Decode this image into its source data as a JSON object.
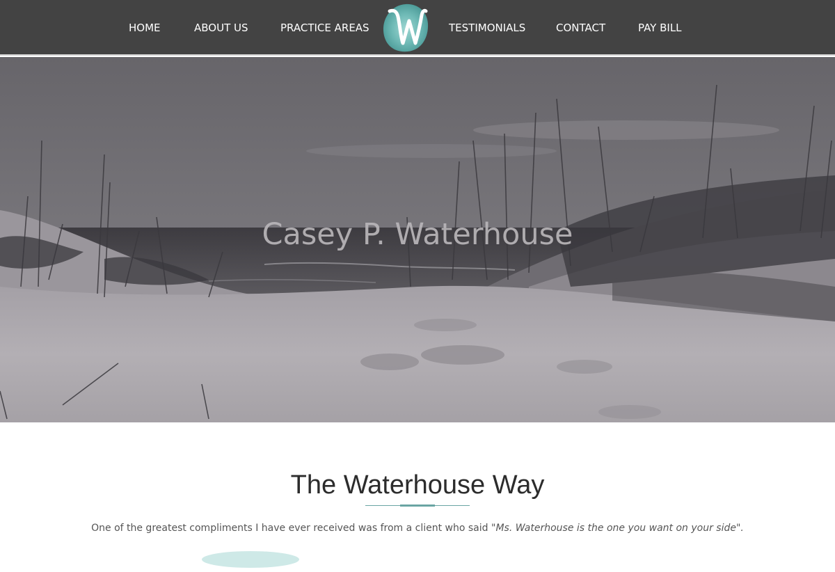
{
  "nav": {
    "items": [
      {
        "label": "HOME"
      },
      {
        "label": "ABOUT US"
      },
      {
        "label": "PRACTICE AREAS"
      },
      {
        "label": "TESTIMONIALS"
      },
      {
        "label": "CONTACT"
      },
      {
        "label": "PAY BILL"
      }
    ],
    "logo": {
      "letter": "W",
      "icon": "watercolor-w-logo",
      "color": "#6fb7b3"
    }
  },
  "hero": {
    "title": "Casey P. Waterhouse",
    "image": "beach-dunes-grass-grayscale"
  },
  "main": {
    "title": "The Waterhouse Way",
    "intro_text": "One of the greatest compliments I have ever received was from a client who said ",
    "intro_quote": "\"Ms. Waterhouse is the one you want on your side\".",
    "accent_color": "#6aa5a3"
  }
}
